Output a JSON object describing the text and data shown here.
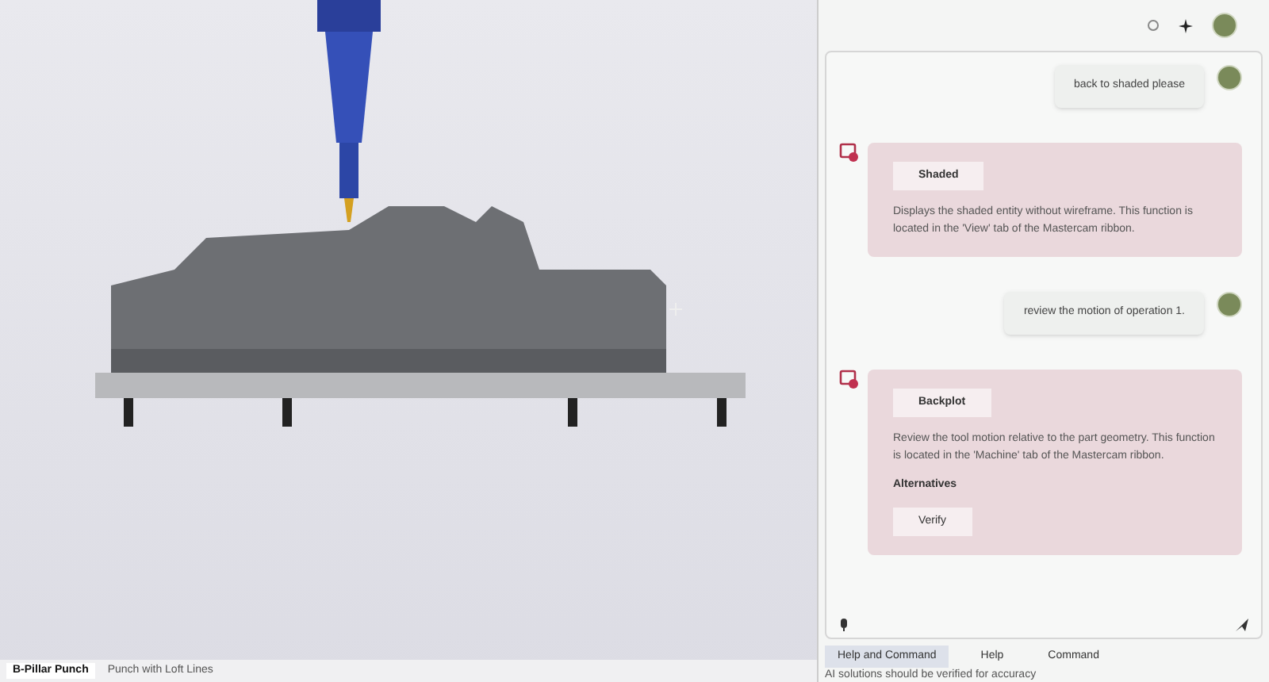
{
  "viewport": {
    "tabs": [
      {
        "label": "B-Pillar Punch",
        "selected": true
      },
      {
        "label": "Punch with Loft Lines",
        "selected": false
      }
    ]
  },
  "chat": {
    "messages": [
      {
        "kind": "user",
        "text": "back to shaded please"
      },
      {
        "kind": "assistant",
        "command": "Shaded",
        "text": "Displays the shaded entity without wireframe. This function is located in the 'View' tab of the Mastercam ribbon."
      },
      {
        "kind": "user",
        "text": "review the motion of operation 1."
      },
      {
        "kind": "assistant",
        "command": "Backplot",
        "text": "Review the tool motion relative to the part geometry. This function is located in the 'Machine' tab of the Mastercam ribbon.",
        "alternatives_label": "Alternatives",
        "alternatives": [
          "Verify"
        ]
      }
    ]
  },
  "modes": [
    {
      "label": "Help and Command",
      "selected": true
    },
    {
      "label": "Help",
      "selected": false
    },
    {
      "label": "Command",
      "selected": false
    }
  ],
  "disclaimer": "AI solutions should be verified for accuracy"
}
